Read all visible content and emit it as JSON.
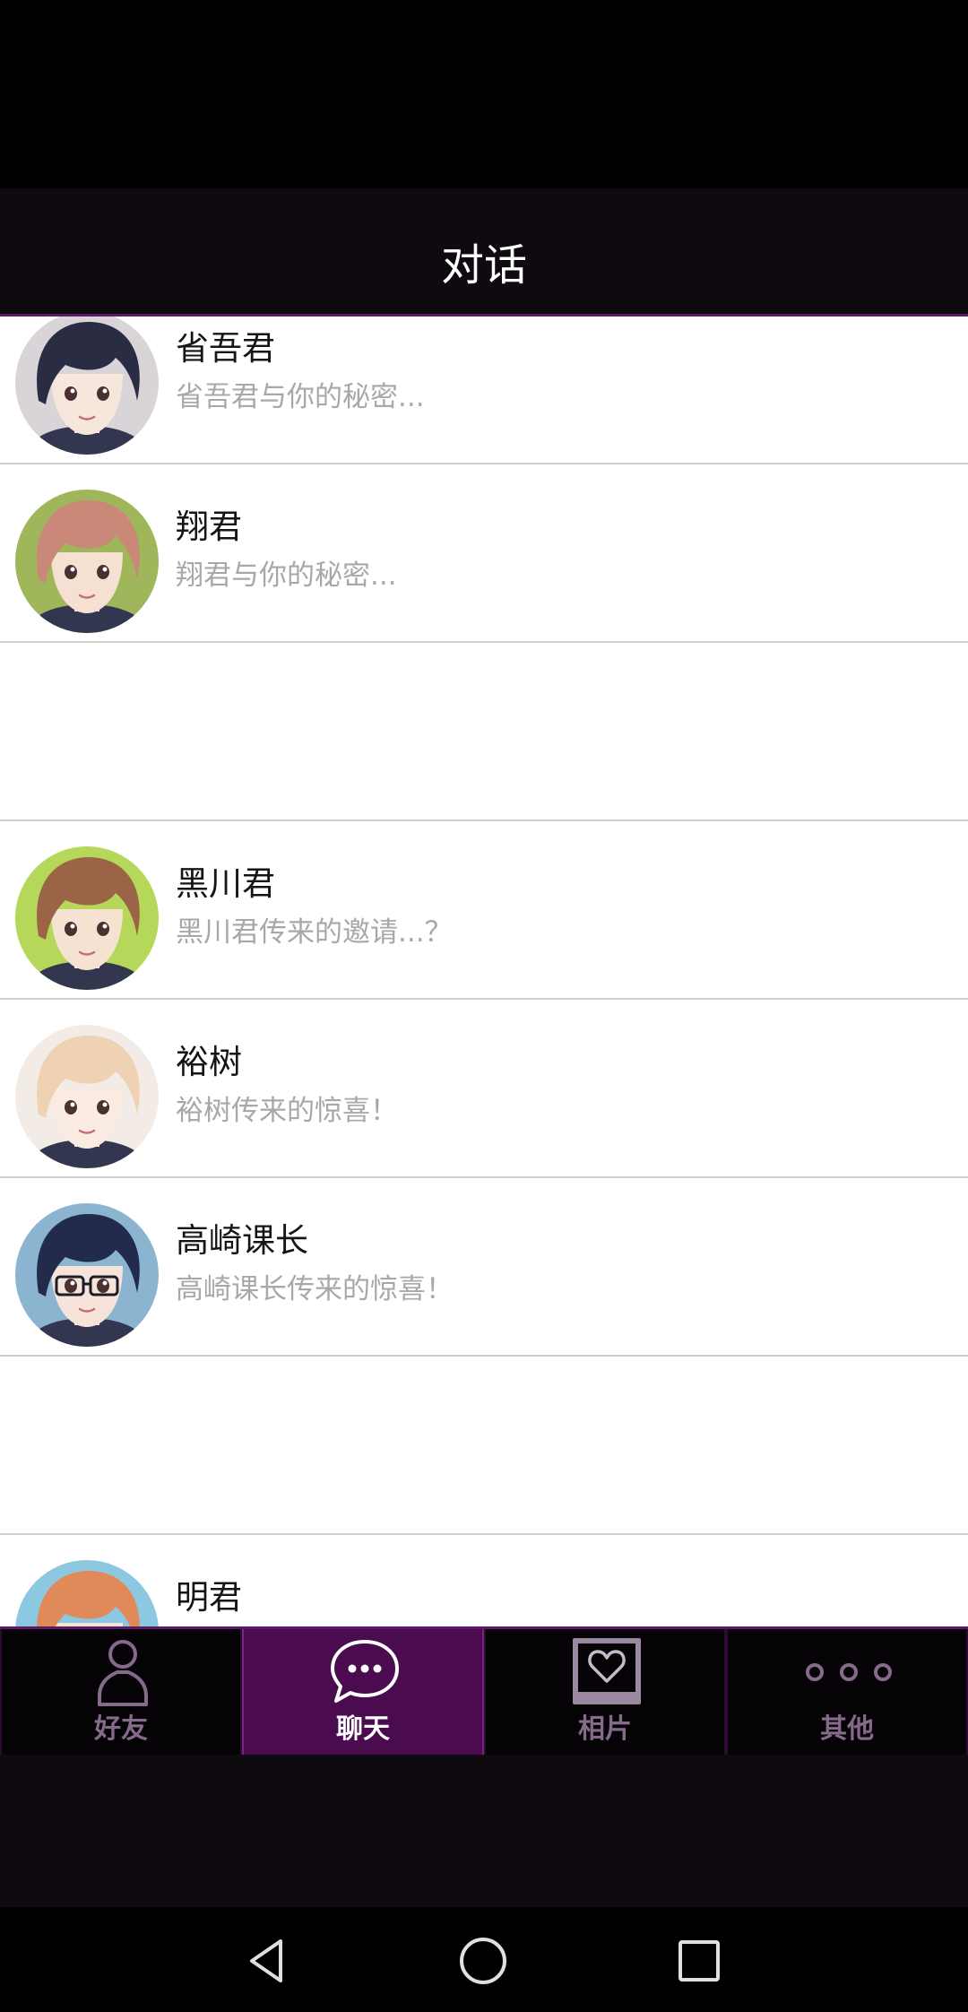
{
  "header": {
    "title": "对话"
  },
  "conversations": [
    {
      "name": "省吾君",
      "preview": "省吾君与你的秘密...",
      "avatar": {
        "hair": "#2a2c44",
        "skin": "#f7e6dc",
        "bg": "#d9d4d8"
      }
    },
    {
      "name": "翔君",
      "preview": "翔君与你的秘密...",
      "avatar": {
        "hair": "#c98878",
        "skin": "#f6e0d2",
        "bg": "#9fb65a"
      }
    },
    {},
    {
      "name": "黑川君",
      "preview": "黑川君传来的邀请...？",
      "avatar": {
        "hair": "#9c6446",
        "skin": "#f6e2d0",
        "bg": "#b5d85a"
      }
    },
    {
      "name": "裕树",
      "preview": "裕树传来的惊喜！",
      "avatar": {
        "hair": "#efd2b4",
        "skin": "#f9ebe2",
        "bg": "#f3ece6"
      }
    },
    {
      "name": "高崎课长",
      "preview": "高崎课长传来的惊喜！",
      "avatar": {
        "hair": "#232b4d",
        "skin": "#f6e4da",
        "bg": "#8ab4d0"
      }
    },
    {},
    {
      "name": "明君",
      "avatar": {
        "hair": "#e08a5a",
        "skin": "#f8e4d6",
        "bg": "#8cc8e0"
      }
    }
  ],
  "tabs": [
    {
      "label": "好友",
      "icon": "person-icon",
      "active": false
    },
    {
      "label": "聊天",
      "icon": "chat-bubble-icon",
      "active": true
    },
    {
      "label": "相片",
      "icon": "photo-heart-icon",
      "active": false
    },
    {
      "label": "其他",
      "icon": "more-dots-icon",
      "active": false
    }
  ],
  "navigation": {
    "back": "back-icon",
    "home": "home-icon",
    "recents": "recents-icon"
  },
  "colors": {
    "accent": "#5d1868",
    "active_tab_bg": "#4a0b4f",
    "tab_inactive": "#866a8c",
    "header_bg": "#0e0a10"
  }
}
